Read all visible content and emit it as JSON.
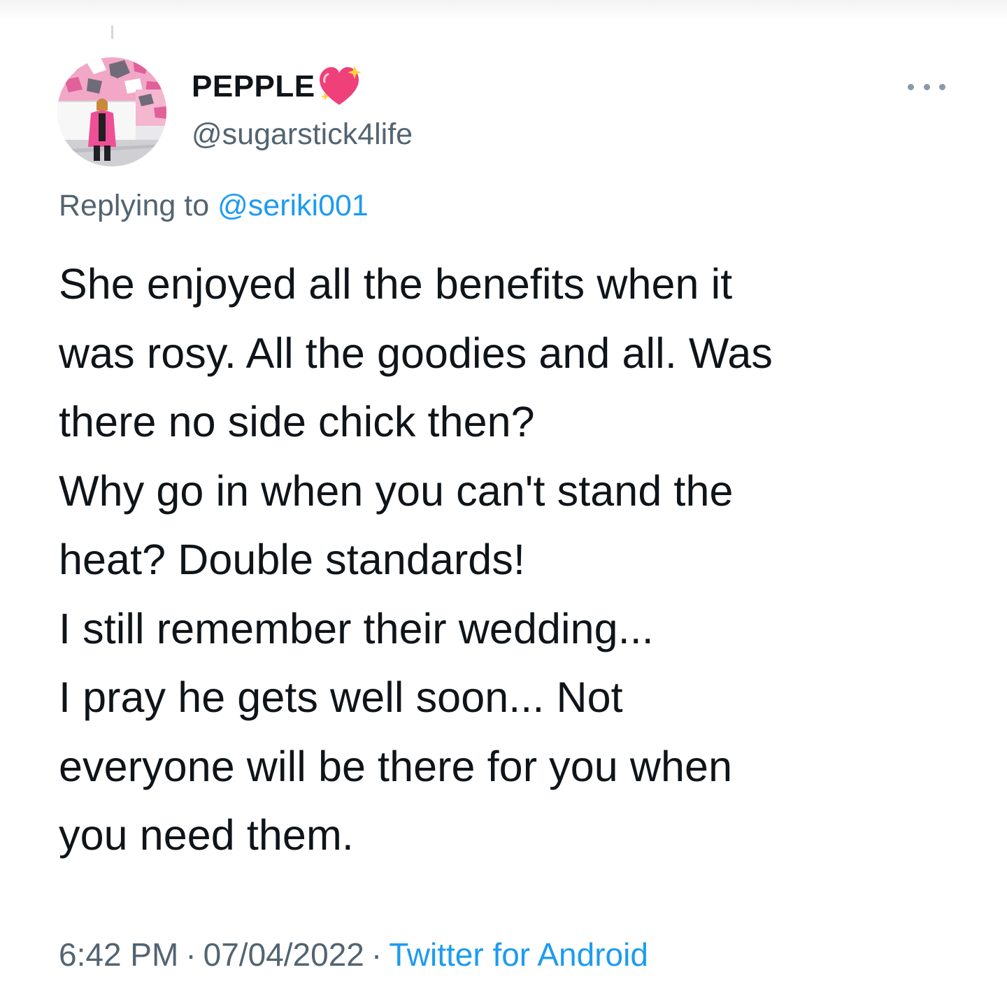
{
  "tweet": {
    "display_name": "PEPPLE",
    "name_emoji": "sparkling-heart-icon",
    "handle": "@sugarstick4life",
    "replying_prefix": "Replying to",
    "replying_to": "@seriki001",
    "text_lines": [
      "She enjoyed all the benefits when it",
      "was rosy. All the goodies and all. Was",
      "there no side chick then?",
      "Why go in when you can't stand the",
      "heat? Double standards!",
      "I still remember their wedding...",
      "I pray he gets well soon... Not",
      "everyone will be there for you when",
      "you need them."
    ],
    "time": "6:42 PM",
    "separator": "·",
    "date": "07/04/2022",
    "source": "Twitter for Android"
  },
  "colors": {
    "text_primary": "#0f1419",
    "text_secondary": "#536471",
    "link": "#1d9bf0",
    "heart": "#f0407a"
  }
}
